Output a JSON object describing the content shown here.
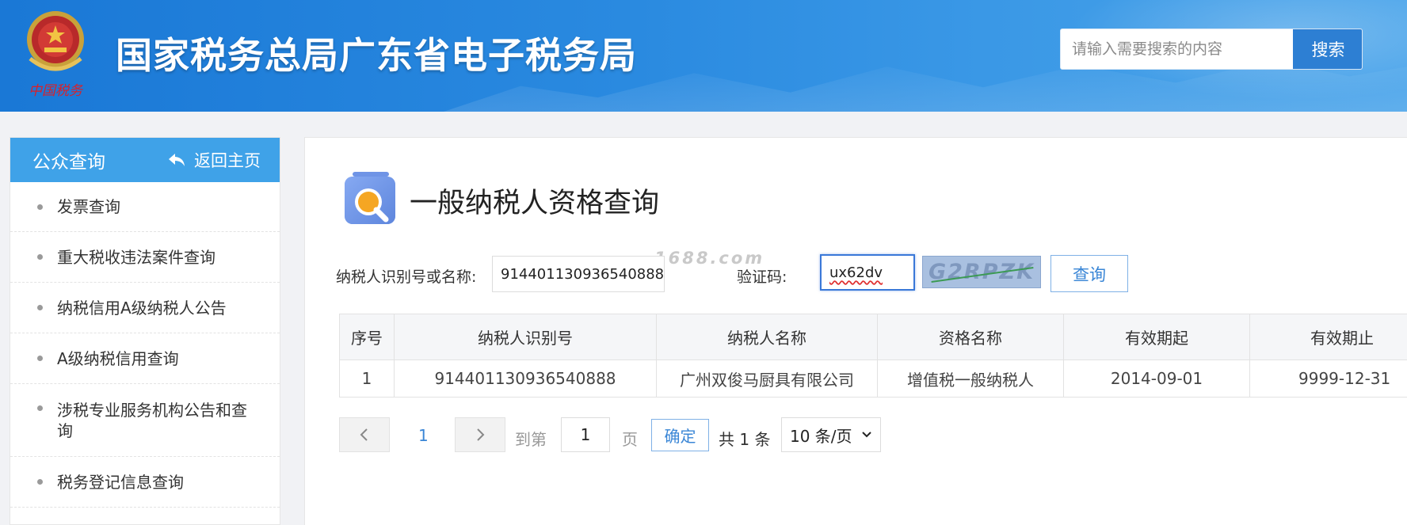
{
  "header": {
    "site_title": "国家税务总局广东省电子税务局",
    "emblem_caption": "中国税务",
    "search": {
      "placeholder": "请输入需要搜索的内容",
      "button_label": "搜索"
    }
  },
  "sidebar": {
    "title": "公众查询",
    "back_label": "返回主页",
    "items": [
      {
        "label": "发票查询"
      },
      {
        "label": "重大税收违法案件查询"
      },
      {
        "label": "纳税信用A级纳税人公告"
      },
      {
        "label": "A级纳税信用查询"
      },
      {
        "label": "涉税专业服务机构公告和查询"
      },
      {
        "label": "税务登记信息查询"
      }
    ]
  },
  "main": {
    "page_title": "一般纳税人资格查询",
    "watermark": "1688.com",
    "form": {
      "taxpayer_label": "纳税人识别号或名称:",
      "taxpayer_value": "914401130936540888",
      "captcha_label": "验证码:",
      "captcha_value": "ux62dv",
      "captcha_image_text": "G2RPZK",
      "query_button": "查询"
    },
    "table": {
      "headers": [
        "序号",
        "纳税人识别号",
        "纳税人名称",
        "资格名称",
        "有效期起",
        "有效期止"
      ],
      "rows": [
        [
          "1",
          "914401130936540888",
          "广州双俊马厨具有限公司",
          "增值税一般纳税人",
          "2014-09-01",
          "9999-12-31"
        ]
      ]
    },
    "pagination": {
      "current_page": "1",
      "goto_label": "到第",
      "goto_value": "1",
      "page_unit": "页",
      "confirm_label": "确定",
      "total_label": "共 1 条",
      "page_size_label": "10 条/页"
    }
  },
  "colors": {
    "header_blue": "#1a78d6",
    "sidebar_head": "#3fa2e8",
    "link_blue": "#3a86d6",
    "search_button": "#2d7fd3"
  }
}
